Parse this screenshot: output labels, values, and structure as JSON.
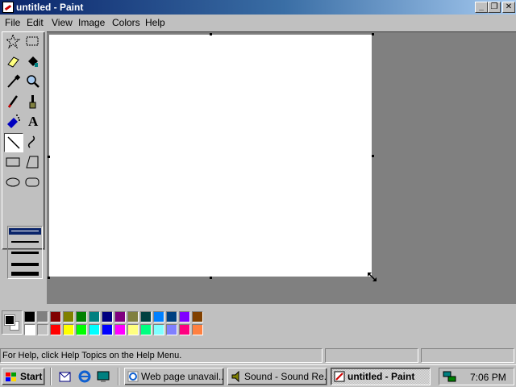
{
  "window": {
    "title": "untitled - Paint",
    "controls": {
      "minimize": "_",
      "maximize": "❐",
      "close": "✕"
    }
  },
  "menu": [
    "File",
    "Edit",
    "View",
    "Image",
    "Colors",
    "Help"
  ],
  "toolbox": {
    "tools": [
      "free-form-select",
      "select",
      "eraser",
      "fill-with-color",
      "pick-color",
      "magnifier",
      "pencil",
      "brush",
      "airbrush",
      "text",
      "line",
      "curve",
      "rectangle",
      "polygon",
      "ellipse",
      "rounded-rectangle"
    ],
    "selected_tool": "line",
    "text_tool_glyph": "A"
  },
  "palette": {
    "foreground": "#000000",
    "background": "#ffffff",
    "row1": [
      "#000000",
      "#808080",
      "#800000",
      "#808000",
      "#008000",
      "#008080",
      "#000080",
      "#800080",
      "#808040",
      "#004040",
      "#0080ff",
      "#004080",
      "#8000ff",
      "#804000"
    ],
    "row2": [
      "#ffffff",
      "#c0c0c0",
      "#ff0000",
      "#ffff00",
      "#00ff00",
      "#00ffff",
      "#0000ff",
      "#ff00ff",
      "#ffff80",
      "#00ff80",
      "#80ffff",
      "#8080ff",
      "#ff0080",
      "#ff8040"
    ]
  },
  "status": {
    "help_text": "For Help, click Help Topics on the Help Menu."
  },
  "taskbar": {
    "start_label": "Start",
    "tasks": [
      {
        "label": "Web page unavail...",
        "icon": "ie-page-icon",
        "active": false
      },
      {
        "label": "Sound - Sound Re...",
        "icon": "sound-recorder-icon",
        "active": false
      },
      {
        "label": "untitled - Paint",
        "icon": "paint-icon",
        "active": true
      }
    ],
    "clock": "7:06 PM"
  }
}
